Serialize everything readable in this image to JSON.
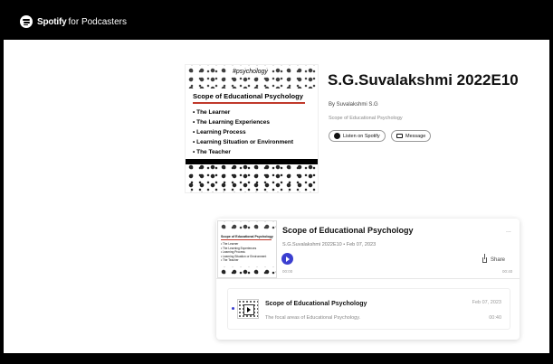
{
  "header": {
    "brand": "Spotify",
    "brand_sub": "for Podcasters",
    "icon": "spotify-logo"
  },
  "show": {
    "title": "S.G.Suvalakshmi 2022E10",
    "author": "By Suvalakshmi S.G",
    "description": "Scope of Educational Psychology",
    "listen_label": "Listen on Spotify",
    "message_label": "Message"
  },
  "cover": {
    "tag": "#psychology",
    "title": "Scope of Educational Psychology",
    "items": [
      "The Learner",
      "The Learning Experiences",
      "Learning Process",
      "Learning Situation or Environment",
      "The Teacher"
    ]
  },
  "episode": {
    "title": "Scope of Educational Psychology",
    "meta": "S.G.Suvalakshmi 2022E10 • Feb 07, 2023",
    "more": "...",
    "share_label": "Share",
    "time_start": "00:00",
    "time_end": "00:40"
  },
  "episode_list": [
    {
      "title": "Scope of Educational Psychology",
      "description": "The focal areas of Educational Psychology.",
      "date": "Feb 07, 2023",
      "duration": "00:40"
    }
  ],
  "colors": {
    "play": "#3b3fd0",
    "accent_line": "#c0392b",
    "topbar": "#000000"
  }
}
